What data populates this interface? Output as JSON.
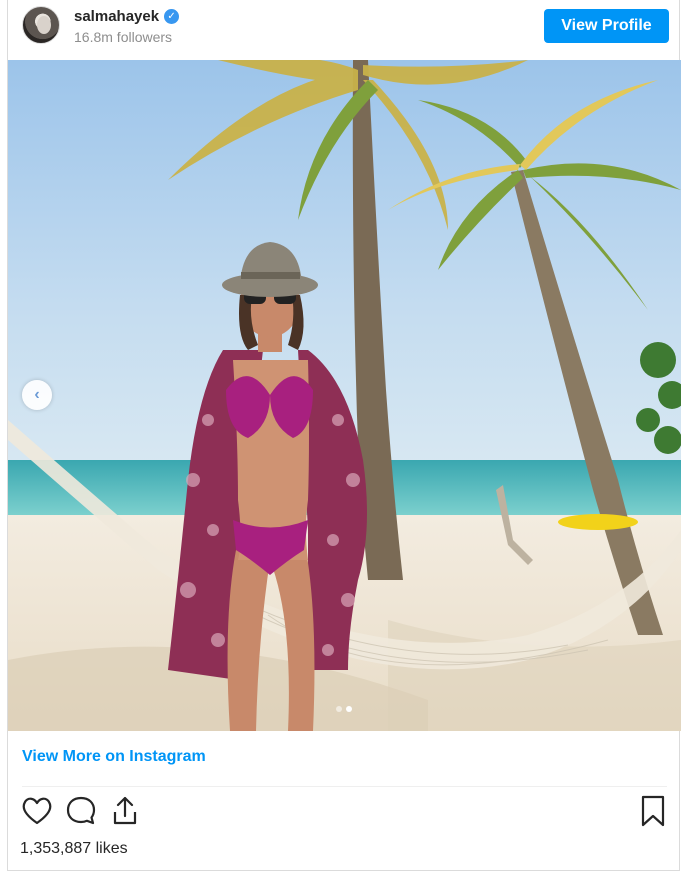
{
  "header": {
    "username": "salmahayek",
    "followers": "16.8m followers",
    "view_profile_label": "View Profile"
  },
  "post": {
    "view_more_label": "View More on Instagram",
    "likes": "1,353,887 likes",
    "carousel": {
      "current": 2,
      "total": 2
    }
  },
  "icons": {
    "like": "heart-icon",
    "comment": "comment-icon",
    "share": "share-icon",
    "save": "bookmark-icon",
    "verified": "verified-badge-icon",
    "prev": "chevron-left-icon"
  },
  "colors": {
    "accent": "#0095f6",
    "text": "#262626",
    "muted": "#8e8e8e"
  }
}
